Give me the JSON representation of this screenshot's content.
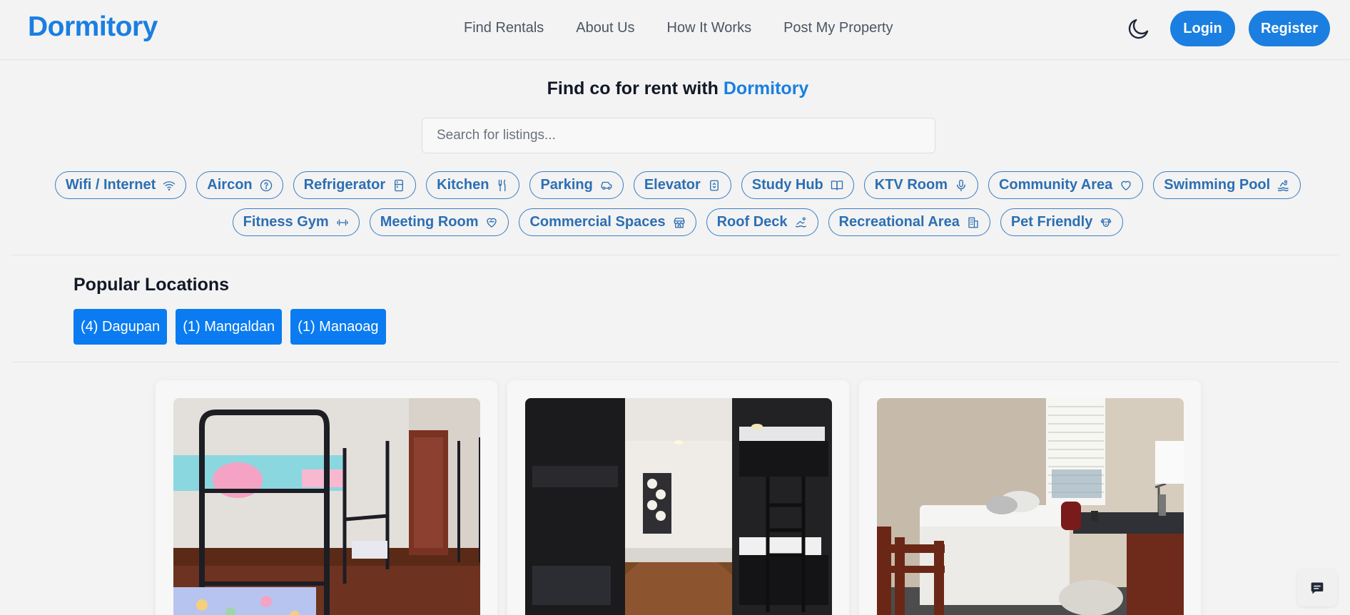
{
  "header": {
    "logo": "Dormitory",
    "nav": [
      "Find Rentals",
      "About Us",
      "How It Works",
      "Post My Property"
    ],
    "theme_icon": "moon-icon",
    "login_label": "Login",
    "register_label": "Register"
  },
  "hero": {
    "title_prefix": "Find co for rent with ",
    "title_brand": "Dormitory",
    "search_placeholder": "Search for listings..."
  },
  "amenities": [
    {
      "label": "Wifi / Internet",
      "icon": "wifi-icon"
    },
    {
      "label": "Aircon",
      "icon": "question-circle-icon"
    },
    {
      "label": "Refrigerator",
      "icon": "refrigerator-icon"
    },
    {
      "label": "Kitchen",
      "icon": "utensils-icon"
    },
    {
      "label": "Parking",
      "icon": "car-icon"
    },
    {
      "label": "Elevator",
      "icon": "elevator-icon"
    },
    {
      "label": "Study Hub",
      "icon": "book-icon"
    },
    {
      "label": "KTV Room",
      "icon": "microphone-icon"
    },
    {
      "label": "Community Area",
      "icon": "heart-icon"
    },
    {
      "label": "Swimming Pool",
      "icon": "swimmer-icon"
    },
    {
      "label": "Fitness Gym",
      "icon": "dumbbell-icon"
    },
    {
      "label": "Meeting Room",
      "icon": "heart-handshake-icon"
    },
    {
      "label": "Commercial Spaces",
      "icon": "store-icon"
    },
    {
      "label": "Roof Deck",
      "icon": "sunbathing-icon"
    },
    {
      "label": "Recreational Area",
      "icon": "building-icon"
    },
    {
      "label": "Pet Friendly",
      "icon": "dog-icon"
    }
  ],
  "popular": {
    "title": "Popular Locations",
    "locations": [
      "(4) Dagupan",
      "(1) Mangaldan",
      "(1) Manaoag"
    ]
  },
  "listings": [
    {
      "image": "bunk-bed-room-photo"
    },
    {
      "image": "hostel-bunks-photo"
    },
    {
      "image": "single-bedroom-photo"
    }
  ],
  "chat_icon": "chat-icon",
  "colors": {
    "accent": "#1a7fe0",
    "chip": "#2c6fb3",
    "location": "#0a7bf0",
    "background": "#f3f3f3"
  }
}
